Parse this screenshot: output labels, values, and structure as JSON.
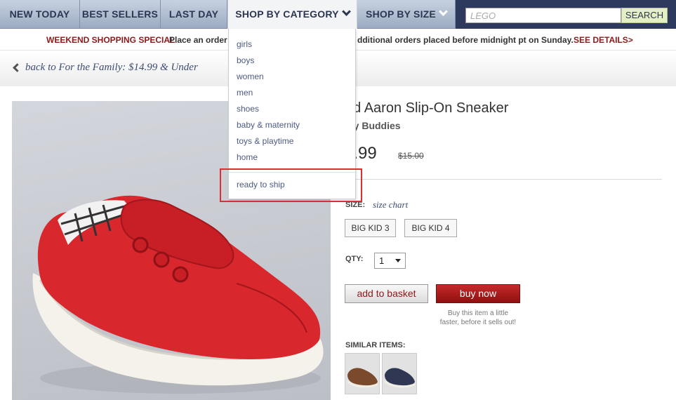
{
  "nav": {
    "items": [
      "NEW TODAY",
      "BEST SELLERS",
      "LAST DAY",
      "SHOP BY CATEGORY",
      "SHOP BY SIZE"
    ],
    "search": {
      "value": "",
      "placeholder": "LEGO",
      "button": "SEARCH"
    }
  },
  "promo": {
    "label": "WEEKEND SHOPPING SPECIAL",
    "text_left": "Place an order",
    "text_right": "dditional orders placed before midnight pt on Sunday.",
    "details": "SEE DETAILS>"
  },
  "back": {
    "text": "back to For the Family: $14.99 & Under"
  },
  "dropdown": {
    "items": [
      "girls",
      "boys",
      "women",
      "men",
      "shoes",
      "baby & maternity",
      "toys & playtime",
      "home"
    ],
    "special": "ready to ship"
  },
  "product": {
    "title": "ed Aaron Slip-On Sneaker",
    "brand": "My Buddies",
    "price": "6.99",
    "original_price": "$15.00",
    "size_label": "SIZE:",
    "size_chart": "size chart",
    "sizes": [
      "BIG KID 3",
      "BIG KID 4"
    ],
    "qty_label": "QTY:",
    "qty": "1",
    "add_button": "add to basket",
    "buy_button": "buy now",
    "buy_note_line1": "Buy this item a little",
    "buy_note_line2": "faster, before it sells out!",
    "similar_label": "SIMILAR ITEMS:"
  },
  "colors": {
    "nav_bg": "#9cabc2",
    "promo_red": "#8b1a1a",
    "buy_red": "#b01c1c",
    "highlight": "#d93030",
    "search_bg": "#2e3a5d"
  },
  "icons": [
    "chevron-down-icon",
    "chevron-left-icon",
    "select-arrow-icon"
  ]
}
